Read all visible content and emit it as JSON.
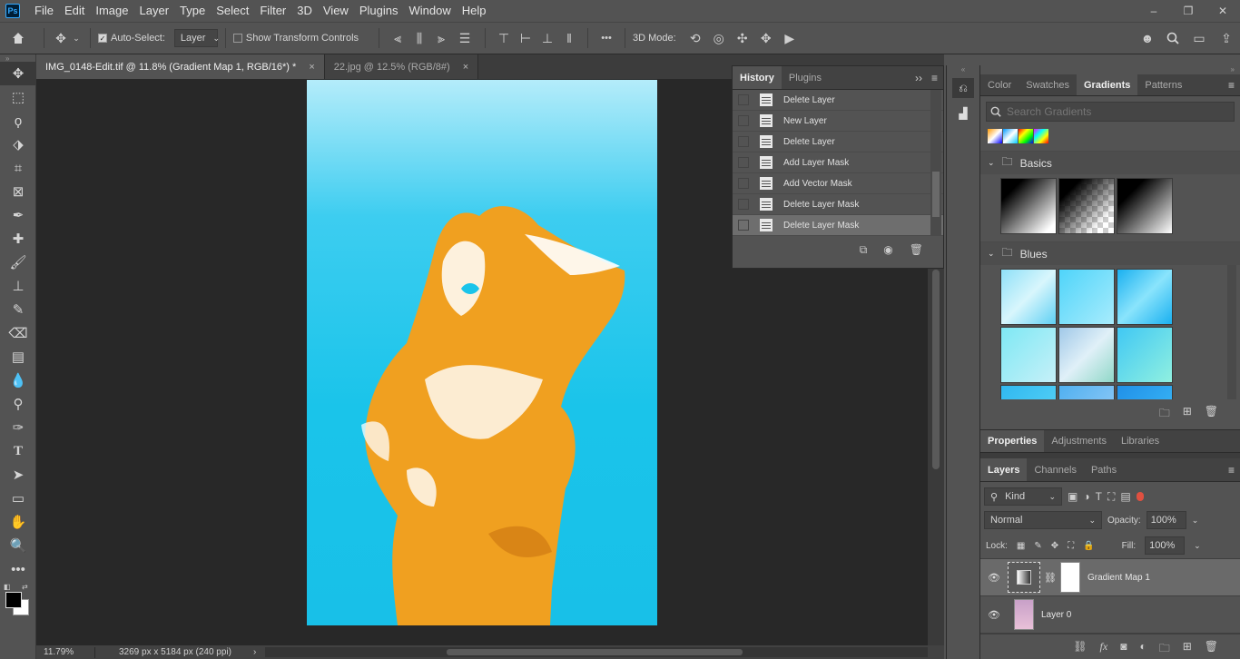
{
  "app": {
    "logo": "Ps"
  },
  "menu": [
    "File",
    "Edit",
    "Image",
    "Layer",
    "Type",
    "Select",
    "Filter",
    "3D",
    "View",
    "Plugins",
    "Window",
    "Help"
  ],
  "window_controls": {
    "minimize": "–",
    "restore": "❐",
    "close": "✕"
  },
  "options": {
    "auto_select_label": "Auto-Select:",
    "auto_select_value": "Layer",
    "show_transform_label": "Show Transform Controls",
    "mode_3d_label": "3D Mode:",
    "more": "•••"
  },
  "doc_tabs": [
    {
      "label": "IMG_0148-Edit.tif @ 11.8% (Gradient Map 1, RGB/16*) *",
      "close": "×",
      "active": true
    },
    {
      "label": "22.jpg @ 12.5% (RGB/8#)",
      "close": "×",
      "active": false
    }
  ],
  "status": {
    "zoom": "11.79%",
    "dimensions": "3269 px x 5184 px (240 ppi)",
    "arrow": "›"
  },
  "history": {
    "tabs": [
      "History",
      "Plugins"
    ],
    "items": [
      "Delete Layer",
      "New Layer",
      "Delete Layer",
      "Add Layer Mask",
      "Add Vector Mask",
      "Delete Layer Mask",
      "Delete Layer Mask"
    ]
  },
  "gradients_panel": {
    "tabs": [
      "Color",
      "Swatches",
      "Gradients",
      "Patterns"
    ],
    "search_placeholder": "Search Gradients",
    "groups": [
      {
        "name": "Basics"
      },
      {
        "name": "Blues"
      }
    ]
  },
  "properties_tabs": [
    "Properties",
    "Adjustments",
    "Libraries"
  ],
  "layers_panel": {
    "tabs": [
      "Layers",
      "Channels",
      "Paths"
    ],
    "kind_label": "Kind",
    "blend_mode": "Normal",
    "opacity_label": "Opacity:",
    "opacity_value": "100%",
    "lock_label": "Lock:",
    "fill_label": "Fill:",
    "fill_value": "100%",
    "layers": [
      {
        "name": "Gradient Map 1",
        "selected": true
      },
      {
        "name": "Layer 0",
        "selected": false
      }
    ]
  },
  "colors": {
    "accent_cyan": "#1ac4ea",
    "figure_orange": "#f0a020"
  }
}
